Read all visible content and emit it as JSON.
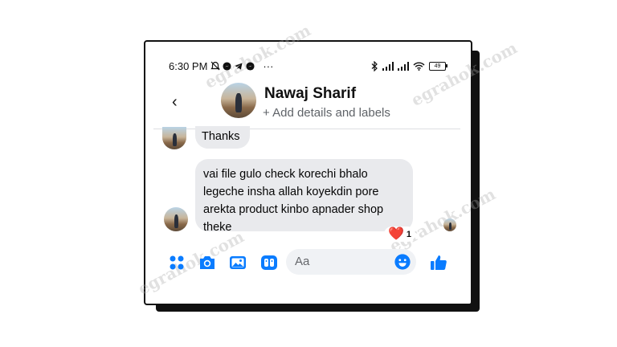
{
  "status_bar": {
    "time": "6:30 PM",
    "more": "···",
    "battery": "49"
  },
  "header": {
    "back_glyph": "‹",
    "contact_name": "Nawaj Sharif",
    "subtitle": "+ Add details and labels"
  },
  "messages": [
    {
      "text": "Thanks"
    },
    {
      "text": "vai file gulo check korechi bhalo legeche insha allah koyekdin pore arekta product kinbo apnader shop theke",
      "reaction": {
        "emoji": "❤️",
        "count": "1"
      }
    }
  ],
  "composer": {
    "placeholder": "Aa",
    "icons": [
      "apps-icon",
      "camera-icon",
      "gallery-icon",
      "sticker-icon",
      "emoji-icon",
      "like-icon"
    ]
  },
  "colors": {
    "accent": "#0a7cff",
    "bubble": "#e9eaed",
    "heart": "#e0245e"
  },
  "watermark": "egrahok.com"
}
